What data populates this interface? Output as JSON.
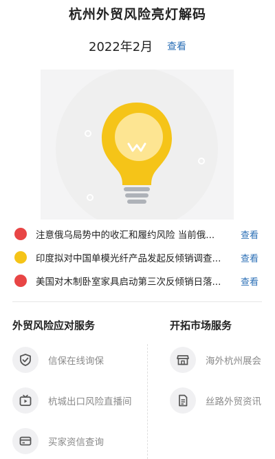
{
  "header": {
    "title": "杭州外贸风险亮灯解码"
  },
  "period": {
    "label": "2022年2月",
    "link": "查看"
  },
  "alerts": [
    {
      "text": "注意俄乌局势中的收汇和履约风险 当前俄...",
      "link": "查看",
      "color": "#e84545"
    },
    {
      "text": "印度拟对中国单模光纤产品发起反倾销调查...",
      "link": "查看",
      "color": "#f5c418"
    },
    {
      "text": "美国对木制卧室家具启动第三次反倾销日落...",
      "link": "查看",
      "color": "#e84545"
    }
  ],
  "sections": {
    "left": {
      "title": "外贸风险应对服务",
      "items": [
        {
          "label": "信保在线询保",
          "icon": "shield-check-icon"
        },
        {
          "label": "杭城出口风险直播间",
          "icon": "tv-play-icon"
        },
        {
          "label": "买家资信查询",
          "icon": "credit-card-icon"
        }
      ]
    },
    "right": {
      "title": "开拓市场服务",
      "items": [
        {
          "label": "海外杭州展会",
          "icon": "storefront-icon"
        },
        {
          "label": "丝路外贸资讯",
          "icon": "document-icon"
        }
      ]
    }
  },
  "colors": {
    "link": "#2b6fb6",
    "bulb": "#f5c418",
    "red": "#e84545",
    "yellow": "#f5c418"
  }
}
